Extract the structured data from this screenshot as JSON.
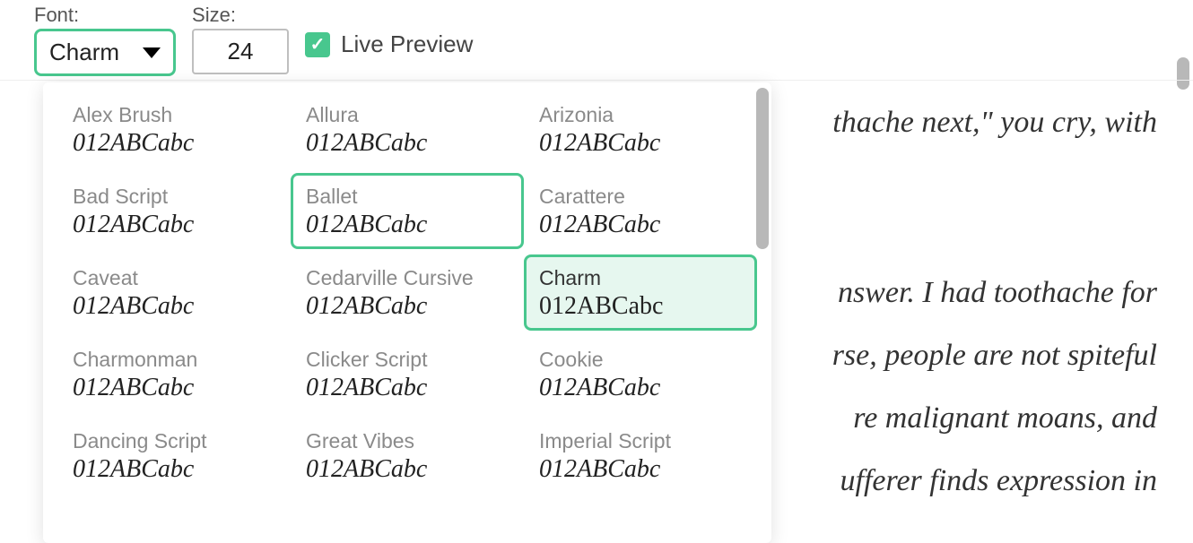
{
  "toolbar": {
    "font_label": "Font:",
    "font_value": "Charm",
    "size_label": "Size:",
    "size_value": "24",
    "live_preview_label": "Live Preview",
    "live_preview_checked": true
  },
  "font_sample_text": "012ABCabc",
  "selected_font": "Charm",
  "hovered_font": "Ballet",
  "fonts": [
    {
      "name": "Alex Brush"
    },
    {
      "name": "Allura"
    },
    {
      "name": "Arizonia"
    },
    {
      "name": "Bad Script"
    },
    {
      "name": "Ballet"
    },
    {
      "name": "Carattere"
    },
    {
      "name": "Caveat"
    },
    {
      "name": "Cedarville Cursive"
    },
    {
      "name": "Charm"
    },
    {
      "name": "Charmonman"
    },
    {
      "name": "Clicker Script"
    },
    {
      "name": "Cookie"
    },
    {
      "name": "Dancing Script"
    },
    {
      "name": "Great Vibes"
    },
    {
      "name": "Imperial Script"
    }
  ],
  "preview_lines": [
    "thache next,\" you cry, with",
    "nswer. I had toothache for",
    "rse, people are not spiteful",
    "re malignant moans, and",
    "ufferer finds expression in"
  ]
}
